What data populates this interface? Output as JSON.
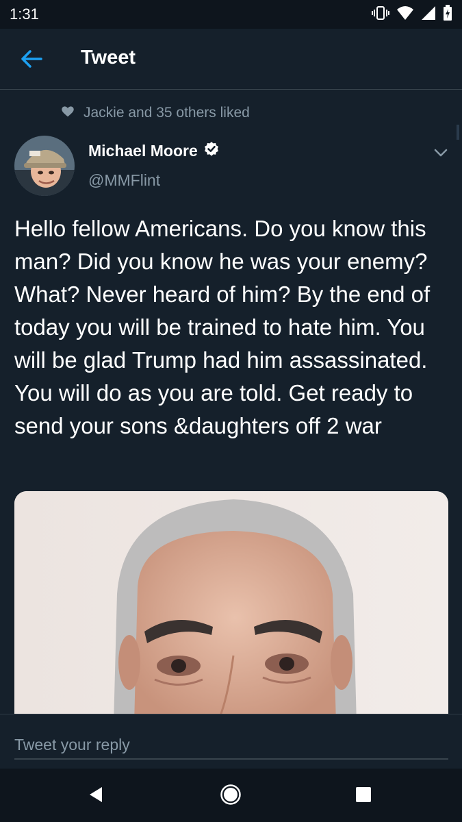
{
  "status_bar": {
    "time": "1:31",
    "icons": [
      "vibrate-icon",
      "wifi-icon",
      "signal-icon",
      "battery-icon"
    ]
  },
  "app_bar": {
    "back_icon": "arrow-left-icon",
    "title": "Tweet"
  },
  "tweet": {
    "social_context": "Jackie and 35 others liked",
    "social_context_icon": "heart-icon",
    "author": {
      "name": "Michael Moore",
      "verified": true,
      "handle": "@MMFlint"
    },
    "text": "Hello fellow Americans. Do you know this man? Did you know he was your enemy? What? Never heard of him? By the end of today you will be trained to hate him. You will be glad Trump had him assassinated. You will do as you are told. Get ready to send your sons &daughters off 2 war",
    "media": {
      "kind": "photo",
      "subject": "portrait-photo"
    }
  },
  "reply": {
    "placeholder": "Tweet your reply"
  },
  "nav_bar": {
    "icons": [
      "back-triangle-icon",
      "home-circle-icon",
      "recents-square-icon"
    ]
  },
  "colors": {
    "background": "#15202b",
    "accent": "#1da1f2",
    "secondary_text": "#8899a6",
    "divider": "#38444d"
  }
}
